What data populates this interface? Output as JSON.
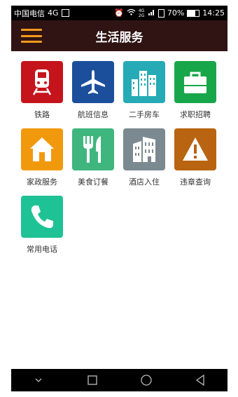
{
  "status": {
    "carrier": "中国电信",
    "network": "4G",
    "signal_label": "4G 2G",
    "battery_percent": "70%",
    "battery_level": 0.7,
    "time": "14:25"
  },
  "header": {
    "title": "生活服务"
  },
  "services": [
    {
      "label": "铁路",
      "icon": "train-icon",
      "color": "#c5141b"
    },
    {
      "label": "航班信息",
      "icon": "airplane-icon",
      "color": "#1b4f9c"
    },
    {
      "label": "二手房车",
      "icon": "buildings-icon",
      "color": "#25aab6"
    },
    {
      "label": "求职招聘",
      "icon": "briefcase-icon",
      "color": "#18a64a"
    },
    {
      "label": "家政服务",
      "icon": "house-icon",
      "color": "#f1990d"
    },
    {
      "label": "美食订餐",
      "icon": "cutlery-icon",
      "color": "#3fb67e"
    },
    {
      "label": "酒店入住",
      "icon": "hotel-icon",
      "color": "#7b8a90"
    },
    {
      "label": "违章查询",
      "icon": "warning-icon",
      "color": "#b86410"
    },
    {
      "label": "常用电话",
      "icon": "phone-icon",
      "color": "#1fc294"
    }
  ]
}
